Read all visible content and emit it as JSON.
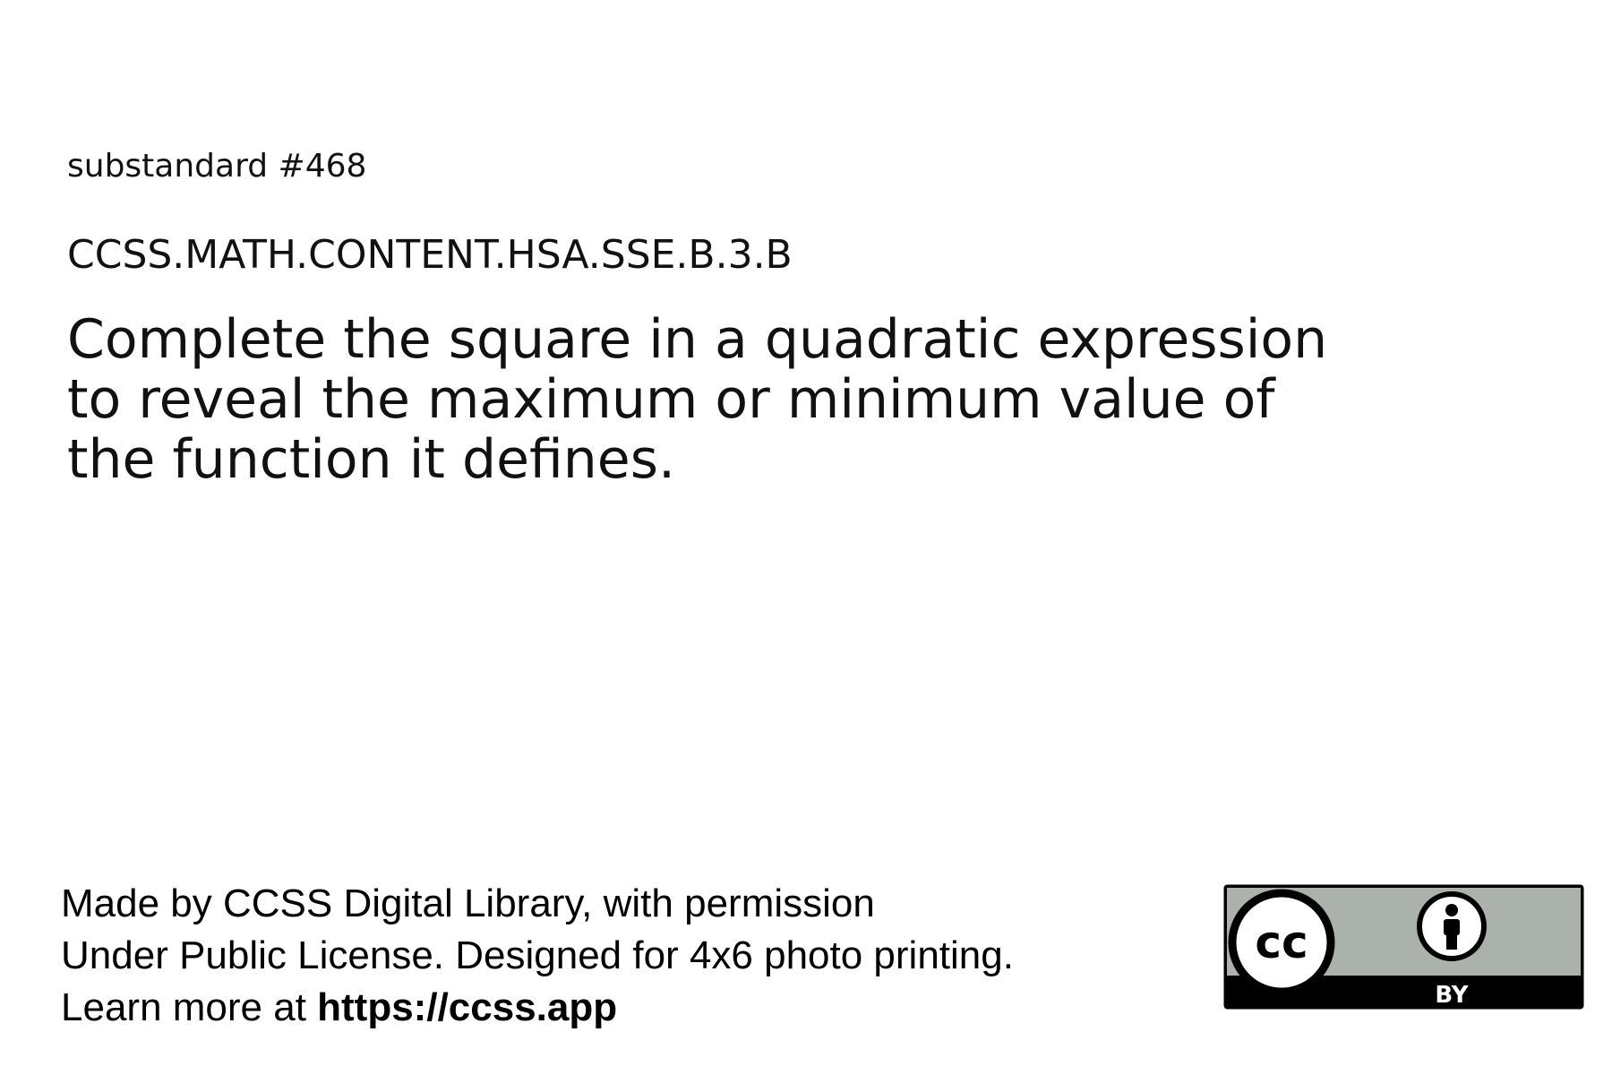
{
  "card": {
    "substandard_label": "substandard #468",
    "code": "CCSS.MATH.CONTENT.HSA.SSE.B.3.B",
    "description": "Complete the square in a quadratic expression to reveal the maximum or minimum value of the function it defines."
  },
  "footer": {
    "line1": "Made by CCSS Digital Library, with permission",
    "line2": "Under Public License. Designed for 4x6 photo printing.",
    "line3_prefix": "Learn more at ",
    "line3_link": "https://ccss.app"
  },
  "license": {
    "cc_text": "cc",
    "by_text": "BY",
    "colors": {
      "top": "#aab2ab",
      "bottom": "#000000",
      "border": "#000000"
    }
  }
}
